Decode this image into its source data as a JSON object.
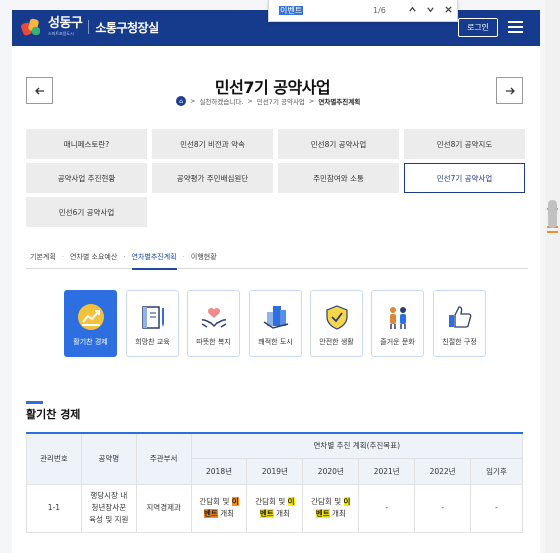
{
  "findbar": {
    "query": "이벤트",
    "count": "1/6",
    "prev_icon": "chevron-up",
    "next_icon": "chevron-down",
    "close_icon": "close"
  },
  "header": {
    "logo_name": "성동구",
    "logo_sub": "스마트포용도시",
    "site_title": "소통구청장실",
    "login_label": "로그인",
    "menu_icon": "hamburger",
    "bg_color": "#163a8c"
  },
  "title": {
    "text": "민선7기 공약사업",
    "prev_icon": "arrow-left",
    "next_icon": "arrow-right"
  },
  "breadcrumb": {
    "home_icon": "home",
    "items": [
      "실천하겠습니다.",
      "민선7기 공약사업",
      "연차별추진계획"
    ]
  },
  "grid": {
    "items": [
      {
        "label": "매니페스토란?"
      },
      {
        "label": "민선8기 비전과 약속"
      },
      {
        "label": "민선8기 공약사업"
      },
      {
        "label": "민선8기 공약지도"
      },
      {
        "label": "공약사업 추진현황"
      },
      {
        "label": "공약평가 주민배심원단"
      },
      {
        "label": "주민참여와 소통"
      },
      {
        "label": "민선7기 공약사업"
      },
      {
        "label": "민선6기 공약사업"
      }
    ],
    "active_index": 7,
    "accent": "#1e3a8a"
  },
  "subtabs": {
    "items": [
      "기본계획",
      "연차별 소요예산",
      "연차별추진계획",
      "이행현황"
    ],
    "active_index": 2
  },
  "categories": {
    "items": [
      {
        "label": "활기찬 경제",
        "icon": "growth-chart-icon"
      },
      {
        "label": "희망찬 교육",
        "icon": "book-icon"
      },
      {
        "label": "따뜻한 복지",
        "icon": "heart-hands-icon"
      },
      {
        "label": "쾌적한 도시",
        "icon": "buildings-icon"
      },
      {
        "label": "안전한 생활",
        "icon": "shield-icon"
      },
      {
        "label": "즐거운 문화",
        "icon": "people-icon"
      },
      {
        "label": "친절한 구정",
        "icon": "thumbs-up-icon"
      }
    ],
    "active_index": 0,
    "accent": "#2d6ee0"
  },
  "section": {
    "title": "활기찬 경제"
  },
  "table": {
    "headers": {
      "id": "관리번호",
      "name": "공약명",
      "dept": "주관부서",
      "plan": "연차별 추진 계획(추진목표)",
      "years": [
        "2018년",
        "2019년",
        "2020년",
        "2021년",
        "2022년",
        "임기후"
      ]
    },
    "rows": [
      {
        "id": "1-1",
        "name": [
          "행당시장 내",
          "청년장사꾼",
          "육성 및 지원"
        ],
        "dept": "지역경제과",
        "years": [
          {
            "pre": "간담회 및 ",
            "hl1": "이",
            "hl2": "벤트",
            "post": " 개최",
            "first": true
          },
          {
            "pre": "간담회 및 ",
            "hl1": "이",
            "hl2": "벤트",
            "post": " 개최",
            "first": false
          },
          {
            "pre": "간담회 및 ",
            "hl1": "이",
            "hl2": "벤트",
            "post": " 개최",
            "first": false
          },
          "-",
          "-",
          "-"
        ]
      }
    ]
  }
}
